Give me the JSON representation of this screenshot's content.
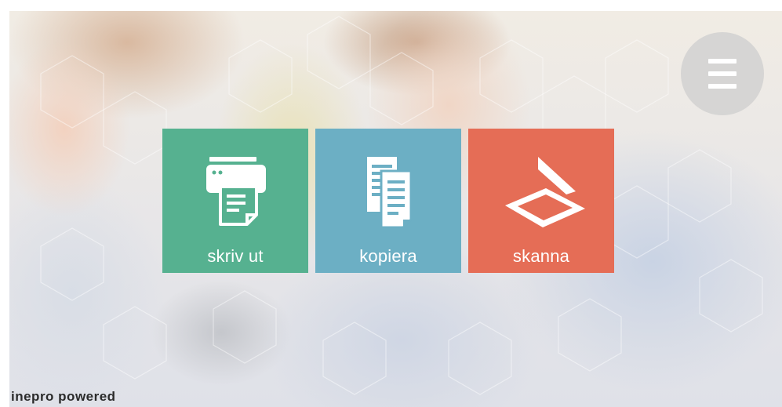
{
  "menu": {
    "icon": "hamburger-menu-icon"
  },
  "actions": [
    {
      "id": "print",
      "label": "skriv ut",
      "icon": "printer-icon",
      "color": "#56b190"
    },
    {
      "id": "copy",
      "label": "kopiera",
      "icon": "copy-documents-icon",
      "color": "#6cafc4"
    },
    {
      "id": "scan",
      "label": "skanna",
      "icon": "scanner-icon",
      "color": "#e56d56"
    }
  ],
  "footer": {
    "branding": "inepro powered"
  }
}
